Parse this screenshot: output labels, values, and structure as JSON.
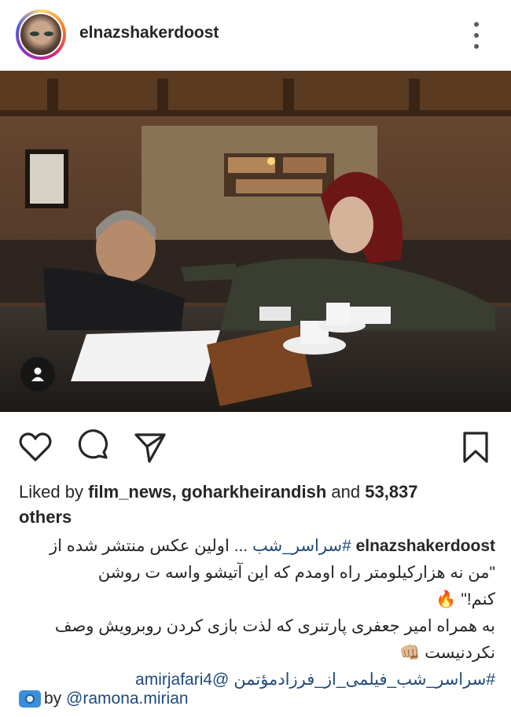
{
  "post": {
    "username": "elnazshakerdoost",
    "liked_by_prefix": "Liked by",
    "liked_by_users": "film_news, goharkheirandish",
    "liked_by_and": "and",
    "like_count": "53,837",
    "liked_by_suffix": "others",
    "caption": {
      "username": "elnazshakerdoost",
      "line1_text": "... اولین عکس منتشر شده از",
      "line1_hashtag": "#سراسر_شب",
      "line2": "\"من نه هزارکیلومتر راه اومدم که این آتیشو واسه ت روشن",
      "line3": "کنم!\" 🔥",
      "line4": "به همراه امیر جعفری پارتنری که لذت بازی کردن روبرویش وصف",
      "line5": "نکردنیست 👊🏼",
      "line6_hashtag": "#سراسر_شب_فیلمی_از_فرزادمؤتمن",
      "line6_mention": "@amirjafari4"
    },
    "credit_prefix": "by",
    "credit_user": "@ramona.mirian"
  },
  "icons": {
    "more": "more-dots-icon",
    "tag": "person-tag-icon",
    "like": "heart-icon",
    "comment": "comment-bubble-icon",
    "share": "paper-plane-icon",
    "save": "bookmark-icon",
    "camera": "camera-emoji-icon"
  }
}
